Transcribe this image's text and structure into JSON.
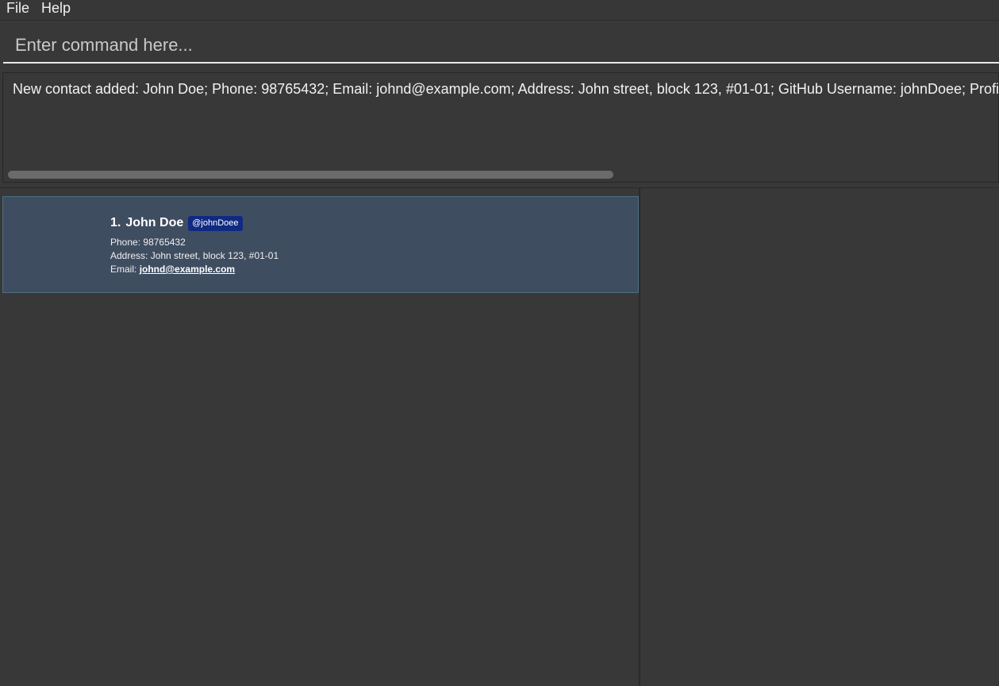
{
  "menu": {
    "file": "File",
    "help": "Help"
  },
  "command": {
    "placeholder": "Enter command here...",
    "value": ""
  },
  "result": {
    "message": "New contact added: John Doe; Phone: 98765432; Email: johnd@example.com; Address: John street, block 123, #01-01; GitHub Username: johnDoee; Profile Pict"
  },
  "persons": [
    {
      "index": "1.",
      "name": "John Doe",
      "github": "@johnDoee",
      "phone_label": "Phone:",
      "phone": "98765432",
      "address_label": "Address:",
      "address": "John street, block 123, #01-01",
      "email_label": "Email:",
      "email": "johnd@example.com"
    }
  ],
  "colors": {
    "background": "#383838",
    "card_selected": "#3f4d61",
    "badge": "#102a82"
  }
}
